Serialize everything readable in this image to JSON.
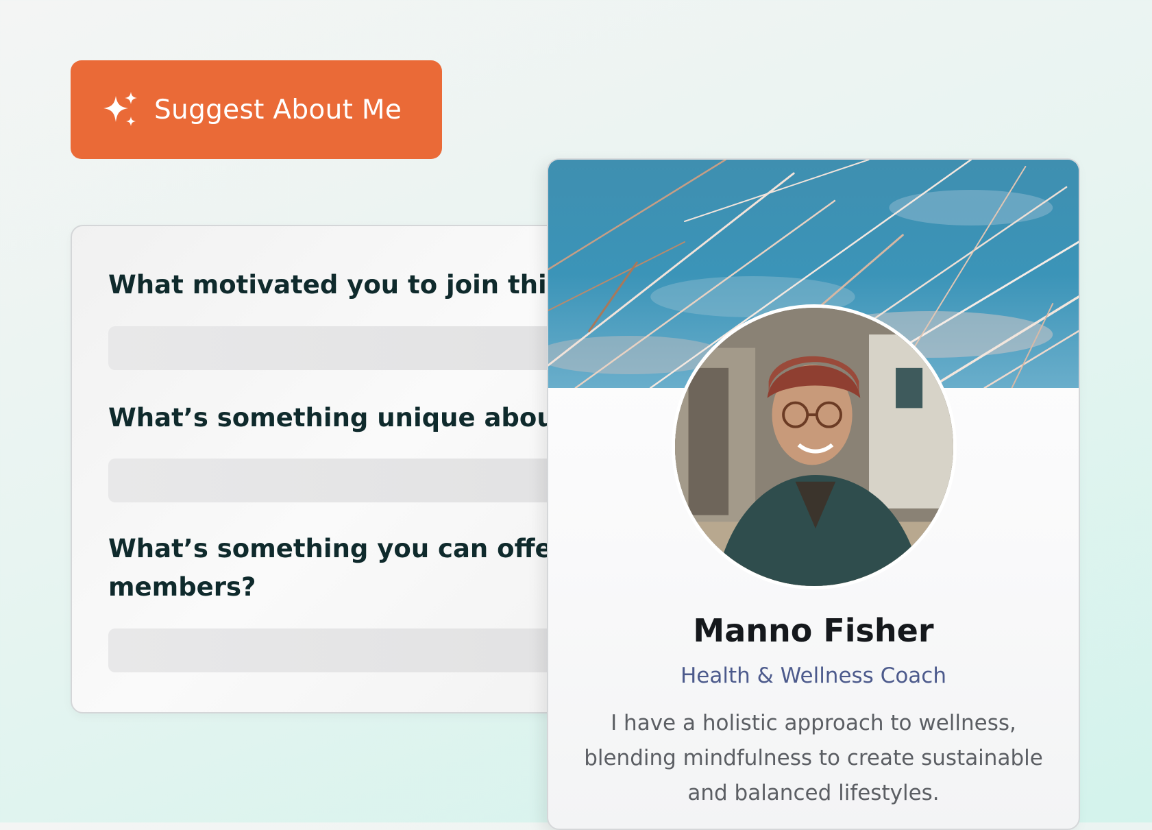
{
  "suggest_button": {
    "label": "Suggest About Me",
    "icon": "sparkles-icon"
  },
  "questions": [
    {
      "label": "What motivated you to join this",
      "value": ""
    },
    {
      "label": "What’s something unique about",
      "value": ""
    },
    {
      "label": "What’s something you can offer\nmembers?",
      "value": ""
    }
  ],
  "profile": {
    "name": "Manno Fisher",
    "role": "Health & Wellness Coach",
    "bio": "I have a holistic approach to wellness, blending mindfulness to create sustainable and balanced lifestyles."
  },
  "colors": {
    "accent": "#ea6a37",
    "heading": "#0f2a2c",
    "role": "#4c5a8c",
    "bio": "#5b5e63"
  }
}
